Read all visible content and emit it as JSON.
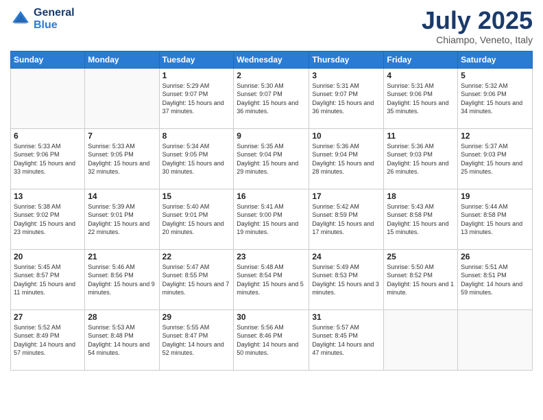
{
  "header": {
    "logo_line1": "General",
    "logo_line2": "Blue",
    "month": "July 2025",
    "location": "Chiampo, Veneto, Italy"
  },
  "weekdays": [
    "Sunday",
    "Monday",
    "Tuesday",
    "Wednesday",
    "Thursday",
    "Friday",
    "Saturday"
  ],
  "weeks": [
    [
      {
        "day": "",
        "info": ""
      },
      {
        "day": "",
        "info": ""
      },
      {
        "day": "1",
        "info": "Sunrise: 5:29 AM\nSunset: 9:07 PM\nDaylight: 15 hours and 37 minutes."
      },
      {
        "day": "2",
        "info": "Sunrise: 5:30 AM\nSunset: 9:07 PM\nDaylight: 15 hours and 36 minutes."
      },
      {
        "day": "3",
        "info": "Sunrise: 5:31 AM\nSunset: 9:07 PM\nDaylight: 15 hours and 36 minutes."
      },
      {
        "day": "4",
        "info": "Sunrise: 5:31 AM\nSunset: 9:06 PM\nDaylight: 15 hours and 35 minutes."
      },
      {
        "day": "5",
        "info": "Sunrise: 5:32 AM\nSunset: 9:06 PM\nDaylight: 15 hours and 34 minutes."
      }
    ],
    [
      {
        "day": "6",
        "info": "Sunrise: 5:33 AM\nSunset: 9:06 PM\nDaylight: 15 hours and 33 minutes."
      },
      {
        "day": "7",
        "info": "Sunrise: 5:33 AM\nSunset: 9:05 PM\nDaylight: 15 hours and 32 minutes."
      },
      {
        "day": "8",
        "info": "Sunrise: 5:34 AM\nSunset: 9:05 PM\nDaylight: 15 hours and 30 minutes."
      },
      {
        "day": "9",
        "info": "Sunrise: 5:35 AM\nSunset: 9:04 PM\nDaylight: 15 hours and 29 minutes."
      },
      {
        "day": "10",
        "info": "Sunrise: 5:36 AM\nSunset: 9:04 PM\nDaylight: 15 hours and 28 minutes."
      },
      {
        "day": "11",
        "info": "Sunrise: 5:36 AM\nSunset: 9:03 PM\nDaylight: 15 hours and 26 minutes."
      },
      {
        "day": "12",
        "info": "Sunrise: 5:37 AM\nSunset: 9:03 PM\nDaylight: 15 hours and 25 minutes."
      }
    ],
    [
      {
        "day": "13",
        "info": "Sunrise: 5:38 AM\nSunset: 9:02 PM\nDaylight: 15 hours and 23 minutes."
      },
      {
        "day": "14",
        "info": "Sunrise: 5:39 AM\nSunset: 9:01 PM\nDaylight: 15 hours and 22 minutes."
      },
      {
        "day": "15",
        "info": "Sunrise: 5:40 AM\nSunset: 9:01 PM\nDaylight: 15 hours and 20 minutes."
      },
      {
        "day": "16",
        "info": "Sunrise: 5:41 AM\nSunset: 9:00 PM\nDaylight: 15 hours and 19 minutes."
      },
      {
        "day": "17",
        "info": "Sunrise: 5:42 AM\nSunset: 8:59 PM\nDaylight: 15 hours and 17 minutes."
      },
      {
        "day": "18",
        "info": "Sunrise: 5:43 AM\nSunset: 8:58 PM\nDaylight: 15 hours and 15 minutes."
      },
      {
        "day": "19",
        "info": "Sunrise: 5:44 AM\nSunset: 8:58 PM\nDaylight: 15 hours and 13 minutes."
      }
    ],
    [
      {
        "day": "20",
        "info": "Sunrise: 5:45 AM\nSunset: 8:57 PM\nDaylight: 15 hours and 11 minutes."
      },
      {
        "day": "21",
        "info": "Sunrise: 5:46 AM\nSunset: 8:56 PM\nDaylight: 15 hours and 9 minutes."
      },
      {
        "day": "22",
        "info": "Sunrise: 5:47 AM\nSunset: 8:55 PM\nDaylight: 15 hours and 7 minutes."
      },
      {
        "day": "23",
        "info": "Sunrise: 5:48 AM\nSunset: 8:54 PM\nDaylight: 15 hours and 5 minutes."
      },
      {
        "day": "24",
        "info": "Sunrise: 5:49 AM\nSunset: 8:53 PM\nDaylight: 15 hours and 3 minutes."
      },
      {
        "day": "25",
        "info": "Sunrise: 5:50 AM\nSunset: 8:52 PM\nDaylight: 15 hours and 1 minute."
      },
      {
        "day": "26",
        "info": "Sunrise: 5:51 AM\nSunset: 8:51 PM\nDaylight: 14 hours and 59 minutes."
      }
    ],
    [
      {
        "day": "27",
        "info": "Sunrise: 5:52 AM\nSunset: 8:49 PM\nDaylight: 14 hours and 57 minutes."
      },
      {
        "day": "28",
        "info": "Sunrise: 5:53 AM\nSunset: 8:48 PM\nDaylight: 14 hours and 54 minutes."
      },
      {
        "day": "29",
        "info": "Sunrise: 5:55 AM\nSunset: 8:47 PM\nDaylight: 14 hours and 52 minutes."
      },
      {
        "day": "30",
        "info": "Sunrise: 5:56 AM\nSunset: 8:46 PM\nDaylight: 14 hours and 50 minutes."
      },
      {
        "day": "31",
        "info": "Sunrise: 5:57 AM\nSunset: 8:45 PM\nDaylight: 14 hours and 47 minutes."
      },
      {
        "day": "",
        "info": ""
      },
      {
        "day": "",
        "info": ""
      }
    ]
  ]
}
